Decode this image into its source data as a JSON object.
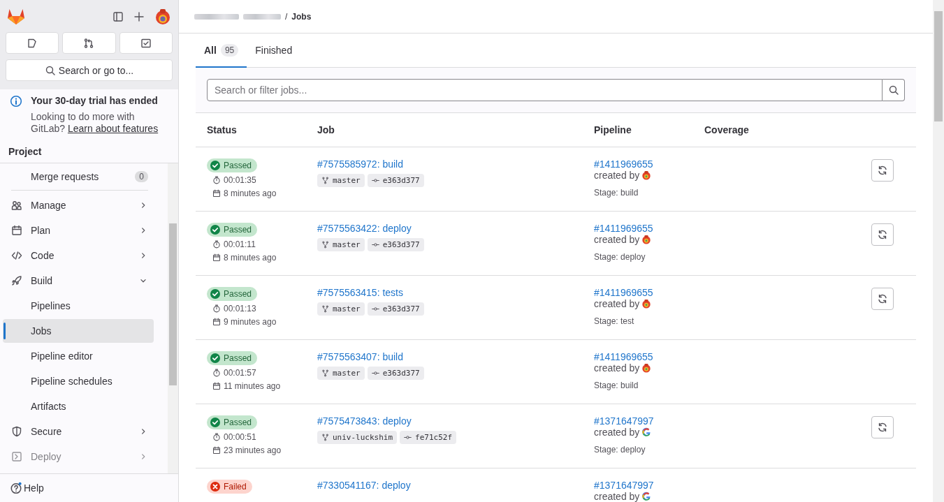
{
  "sidebar": {
    "search_button": "Search or go to...",
    "trial": {
      "title": "Your 30-day trial has ended",
      "text": "Looking to do more with GitLab? ",
      "link": "Learn about features"
    },
    "section_title": "Project",
    "items": [
      {
        "kind": "sub",
        "label": "Merge requests",
        "count": "0",
        "selected": false
      },
      {
        "kind": "group",
        "label": "Manage",
        "expanded": false
      },
      {
        "kind": "group",
        "label": "Plan",
        "expanded": false
      },
      {
        "kind": "group",
        "label": "Code",
        "expanded": false
      },
      {
        "kind": "group",
        "label": "Build",
        "expanded": true
      },
      {
        "kind": "sub",
        "label": "Pipelines",
        "selected": false
      },
      {
        "kind": "sub",
        "label": "Jobs",
        "selected": true
      },
      {
        "kind": "sub",
        "label": "Pipeline editor",
        "selected": false
      },
      {
        "kind": "sub",
        "label": "Pipeline schedules",
        "selected": false
      },
      {
        "kind": "sub",
        "label": "Artifacts",
        "selected": false
      },
      {
        "kind": "group",
        "label": "Secure",
        "expanded": false
      },
      {
        "kind": "group",
        "label": "Deploy",
        "expanded": false
      }
    ],
    "help": "Help"
  },
  "breadcrumb": {
    "separator": "/",
    "current": "Jobs"
  },
  "tabs": [
    {
      "label": "All",
      "count": "95",
      "selected": true
    },
    {
      "label": "Finished",
      "selected": false
    }
  ],
  "search": {
    "placeholder": "Search or filter jobs..."
  },
  "table": {
    "columns": [
      "Status",
      "Job",
      "Pipeline",
      "Coverage"
    ],
    "rows": [
      {
        "kind": "passed",
        "status_label": "Passed",
        "duration": "00:01:35",
        "finished": "8 minutes ago",
        "job": "#7575585972: build",
        "branch": "master",
        "commit": "e363d377",
        "pipeline": "#1411969655",
        "created_by": "created by",
        "avatar": {
          "kind": "user"
        },
        "stage": "Stage: build",
        "retryable": true
      },
      {
        "kind": "passed",
        "status_label": "Passed",
        "duration": "00:01:11",
        "finished": "8 minutes ago",
        "job": "#7575563422: deploy",
        "branch": "master",
        "commit": "e363d377",
        "pipeline": "#1411969655",
        "created_by": "created by",
        "avatar": {
          "kind": "user"
        },
        "stage": "Stage: deploy",
        "retryable": true
      },
      {
        "kind": "passed",
        "status_label": "Passed",
        "duration": "00:01:13",
        "finished": "9 minutes ago",
        "job": "#7575563415: tests",
        "branch": "master",
        "commit": "e363d377",
        "pipeline": "#1411969655",
        "created_by": "created by",
        "avatar": {
          "kind": "user"
        },
        "stage": "Stage: test",
        "retryable": true
      },
      {
        "kind": "passed",
        "status_label": "Passed",
        "duration": "00:01:57",
        "finished": "11 minutes ago",
        "job": "#7575563407: build",
        "branch": "master",
        "commit": "e363d377",
        "pipeline": "#1411969655",
        "created_by": "created by",
        "avatar": {
          "kind": "user"
        },
        "stage": "Stage: build",
        "retryable": false
      },
      {
        "kind": "passed",
        "status_label": "Passed",
        "duration": "00:00:51",
        "finished": "23 minutes ago",
        "job": "#7575473843: deploy",
        "branch": "univ-luckshim",
        "commit": "fe71c52f",
        "pipeline": "#1371647997",
        "created_by": "created by",
        "avatar": {
          "kind": "ring"
        },
        "stage": "Stage: deploy",
        "retryable": true
      },
      {
        "kind": "failed",
        "status_label": "Failed",
        "job": "#7330541167: deploy",
        "pipeline": "#1371647997",
        "created_by": "created by",
        "avatar": {
          "kind": "ring"
        }
      }
    ]
  }
}
